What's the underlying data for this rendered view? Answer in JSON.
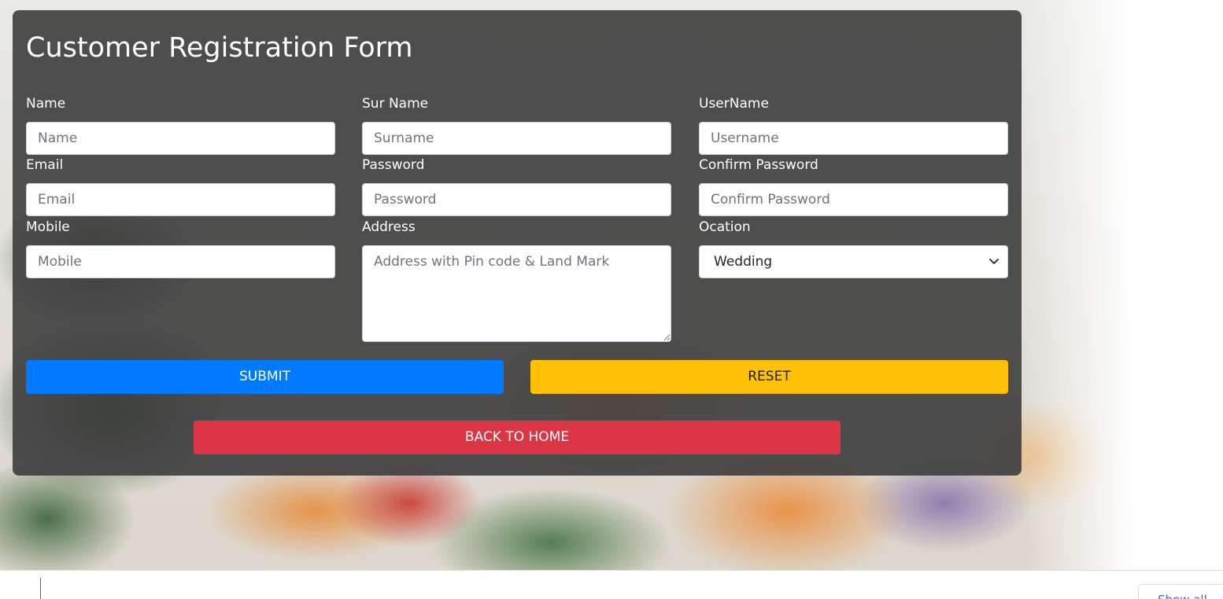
{
  "form": {
    "title": "Customer Registration Form",
    "fields": {
      "name": {
        "label": "Name",
        "placeholder": "Name"
      },
      "surname": {
        "label": "Sur Name",
        "placeholder": "Surname"
      },
      "username": {
        "label": "UserName",
        "placeholder": "Username"
      },
      "email": {
        "label": "Email",
        "placeholder": "Email"
      },
      "password": {
        "label": "Password",
        "placeholder": "Password"
      },
      "confirm_password": {
        "label": "Confirm Password",
        "placeholder": "Confirm Password"
      },
      "mobile": {
        "label": "Mobile",
        "placeholder": "Mobile"
      },
      "address": {
        "label": "Address",
        "placeholder": "Address with Pin code & Land Mark"
      },
      "ocation": {
        "label": "Ocation",
        "selected": "Wedding"
      }
    },
    "buttons": {
      "submit": "SUBMIT",
      "reset": "RESET",
      "back_home": "BACK TO HOME"
    }
  },
  "download_bar": {
    "show_all_label": "Show all"
  },
  "colors": {
    "card_bg": "#404040",
    "submit": "#007bff",
    "reset": "#ffc107",
    "back_home": "#dc3545",
    "link_blue": "#1a73e8"
  }
}
